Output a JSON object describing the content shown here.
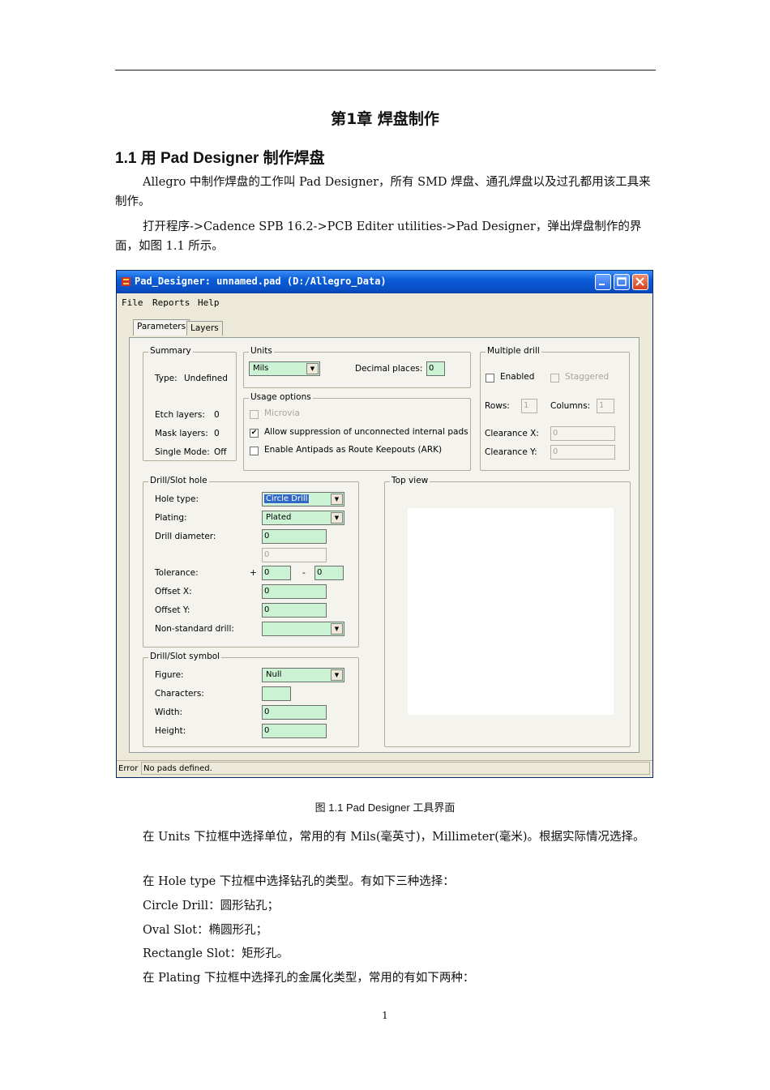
{
  "chapter_title": "第1章  焊盘制作",
  "section_title": "1.1   用 Pad Designer 制作焊盘",
  "paragraphs": {
    "p1": "Allegro 中制作焊盘的工作叫 Pad Designer，所有 SMD 焊盘、通孔焊盘以及过孔都用该工具来制作。",
    "p2": "打开程序->Cadence SPB 16.2->PCB Editer utilities->Pad Designer，弹出焊盘制作的界面，如图  1.1 所示。",
    "p3": "在 Units 下拉框中选择单位，常用的有 Mils(毫英寸)，Millimeter(毫米)。根据实际情况选择。",
    "p4": "在 Hole type 下拉框中选择钻孔的类型。有如下三种选择：",
    "p5": "Circle Drill：圆形钻孔；",
    "p6": "Oval Slot：椭圆形孔；",
    "p7": "Rectangle Slot：矩形孔。",
    "p8": "在 Plating 下拉框中选择孔的金属化类型，常用的有如下两种："
  },
  "figure_caption": "图  1.1    Pad Designer 工具界面",
  "page_number": "1",
  "window": {
    "title": "Pad_Designer: unnamed.pad (D:/Allegro_Data)",
    "menu": [
      "File",
      "Reports",
      "Help"
    ],
    "tabs": [
      "Parameters",
      "Layers"
    ],
    "summary": {
      "legend": "Summary",
      "type_label": "Type:",
      "type_value": "Undefined",
      "etch_label": "Etch layers:",
      "etch_value": "0",
      "mask_label": "Mask layers:",
      "mask_value": "0",
      "single_label": "Single Mode:",
      "single_value": "Off"
    },
    "units": {
      "legend": "Units",
      "selected": "Mils",
      "decimal_label": "Decimal places:",
      "decimal_value": "0"
    },
    "usage": {
      "legend": "Usage options",
      "microvia": "Microvia",
      "allow_suppression": "Allow suppression of unconnected internal pads",
      "enable_antipads": "Enable Antipads as Route Keepouts (ARK)",
      "checkmark": "✔"
    },
    "multiple_drill": {
      "legend": "Multiple drill",
      "enabled": "Enabled",
      "staggered": "Staggered",
      "rows_label": "Rows:",
      "rows_value": "1",
      "columns_label": "Columns:",
      "columns_value": "1",
      "clearance_x_label": "Clearance X:",
      "clearance_x_value": "0",
      "clearance_y_label": "Clearance Y:",
      "clearance_y_value": "0"
    },
    "drill_hole": {
      "legend": "Drill/Slot hole",
      "hole_type_label": "Hole type:",
      "hole_type_value": "Circle Drill",
      "plating_label": "Plating:",
      "plating_value": "Plated",
      "diameter_label": "Drill diameter:",
      "diameter_value": "0",
      "diameter2_value": "0",
      "tolerance_label": "Tolerance:",
      "tol_plus_sign": "+",
      "tol_plus_value": "0",
      "tol_minus_sign": "-",
      "tol_minus_value": "0",
      "offset_x_label": "Offset X:",
      "offset_x_value": "0",
      "offset_y_label": "Offset Y:",
      "offset_y_value": "0",
      "nonstandard_label": "Non-standard drill:",
      "nonstandard_value": ""
    },
    "drill_symbol": {
      "legend": "Drill/Slot symbol",
      "figure_label": "Figure:",
      "figure_value": "Null",
      "characters_label": "Characters:",
      "characters_value": "",
      "width_label": "Width:",
      "width_value": "0",
      "height_label": "Height:",
      "height_value": "0"
    },
    "top_view_legend": "Top view",
    "status": {
      "label": "Error",
      "message": "No pads defined."
    }
  },
  "colors": {
    "titlebar": "#0b5cd8",
    "window_bg": "#ece9d8",
    "field_green": "#ccf2d4",
    "selection": "#3169c6"
  }
}
